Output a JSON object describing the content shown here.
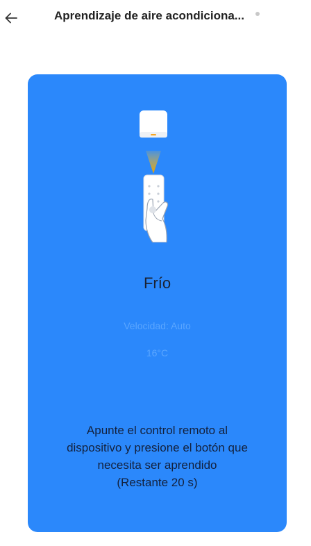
{
  "header": {
    "title": "Aprendizaje de aire acondiciona...",
    "back_icon": "arrow-left-icon"
  },
  "card": {
    "background_color": "#2b88fb",
    "illustration": {
      "device_icon": "ac-receiver-icon",
      "remote_icon": "remote-in-hand-icon",
      "signal_color": "#f0b429"
    },
    "mode": "Frío",
    "speed": "Velocidad: Auto",
    "temperature": "16°C",
    "instructions": {
      "line1": "Apunte el control remoto al",
      "line2": "dispositivo y presione el botón que",
      "line3": "necesita ser aprendido",
      "line4": "(Restante 20 s)"
    }
  }
}
